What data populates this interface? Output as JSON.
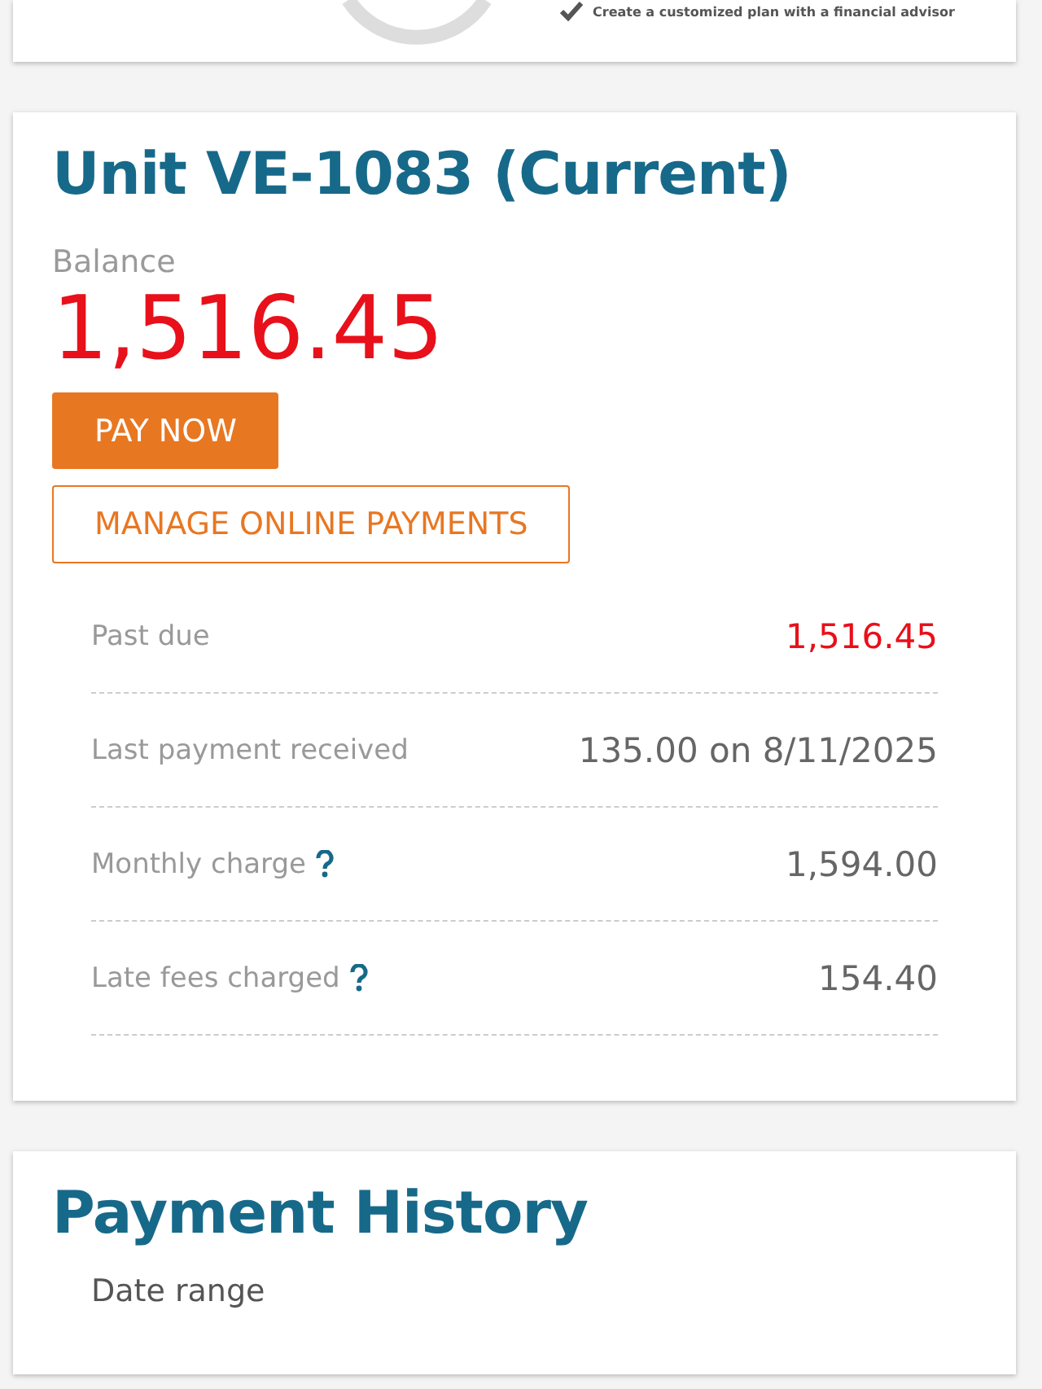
{
  "top_card": {
    "benefit": "Create a customized plan with a financial advisor"
  },
  "unit": {
    "title": "Unit VE-1083 (Current)",
    "balance_label": "Balance",
    "balance": "1,516.45",
    "pay_button": "PAY NOW",
    "manage_button": "MANAGE ONLINE PAYMENTS",
    "rows": [
      {
        "label": "Past due",
        "value": "1,516.45",
        "alert": true,
        "help": false
      },
      {
        "label": "Last payment received",
        "value": "135.00 on 8/11/2025",
        "alert": false,
        "help": false
      },
      {
        "label": "Monthly charge",
        "value": "1,594.00",
        "alert": false,
        "help": true
      },
      {
        "label": "Late fees charged",
        "value": "154.40",
        "alert": false,
        "help": true
      }
    ]
  },
  "history": {
    "title": "Payment History",
    "filter_label": "Date range"
  }
}
